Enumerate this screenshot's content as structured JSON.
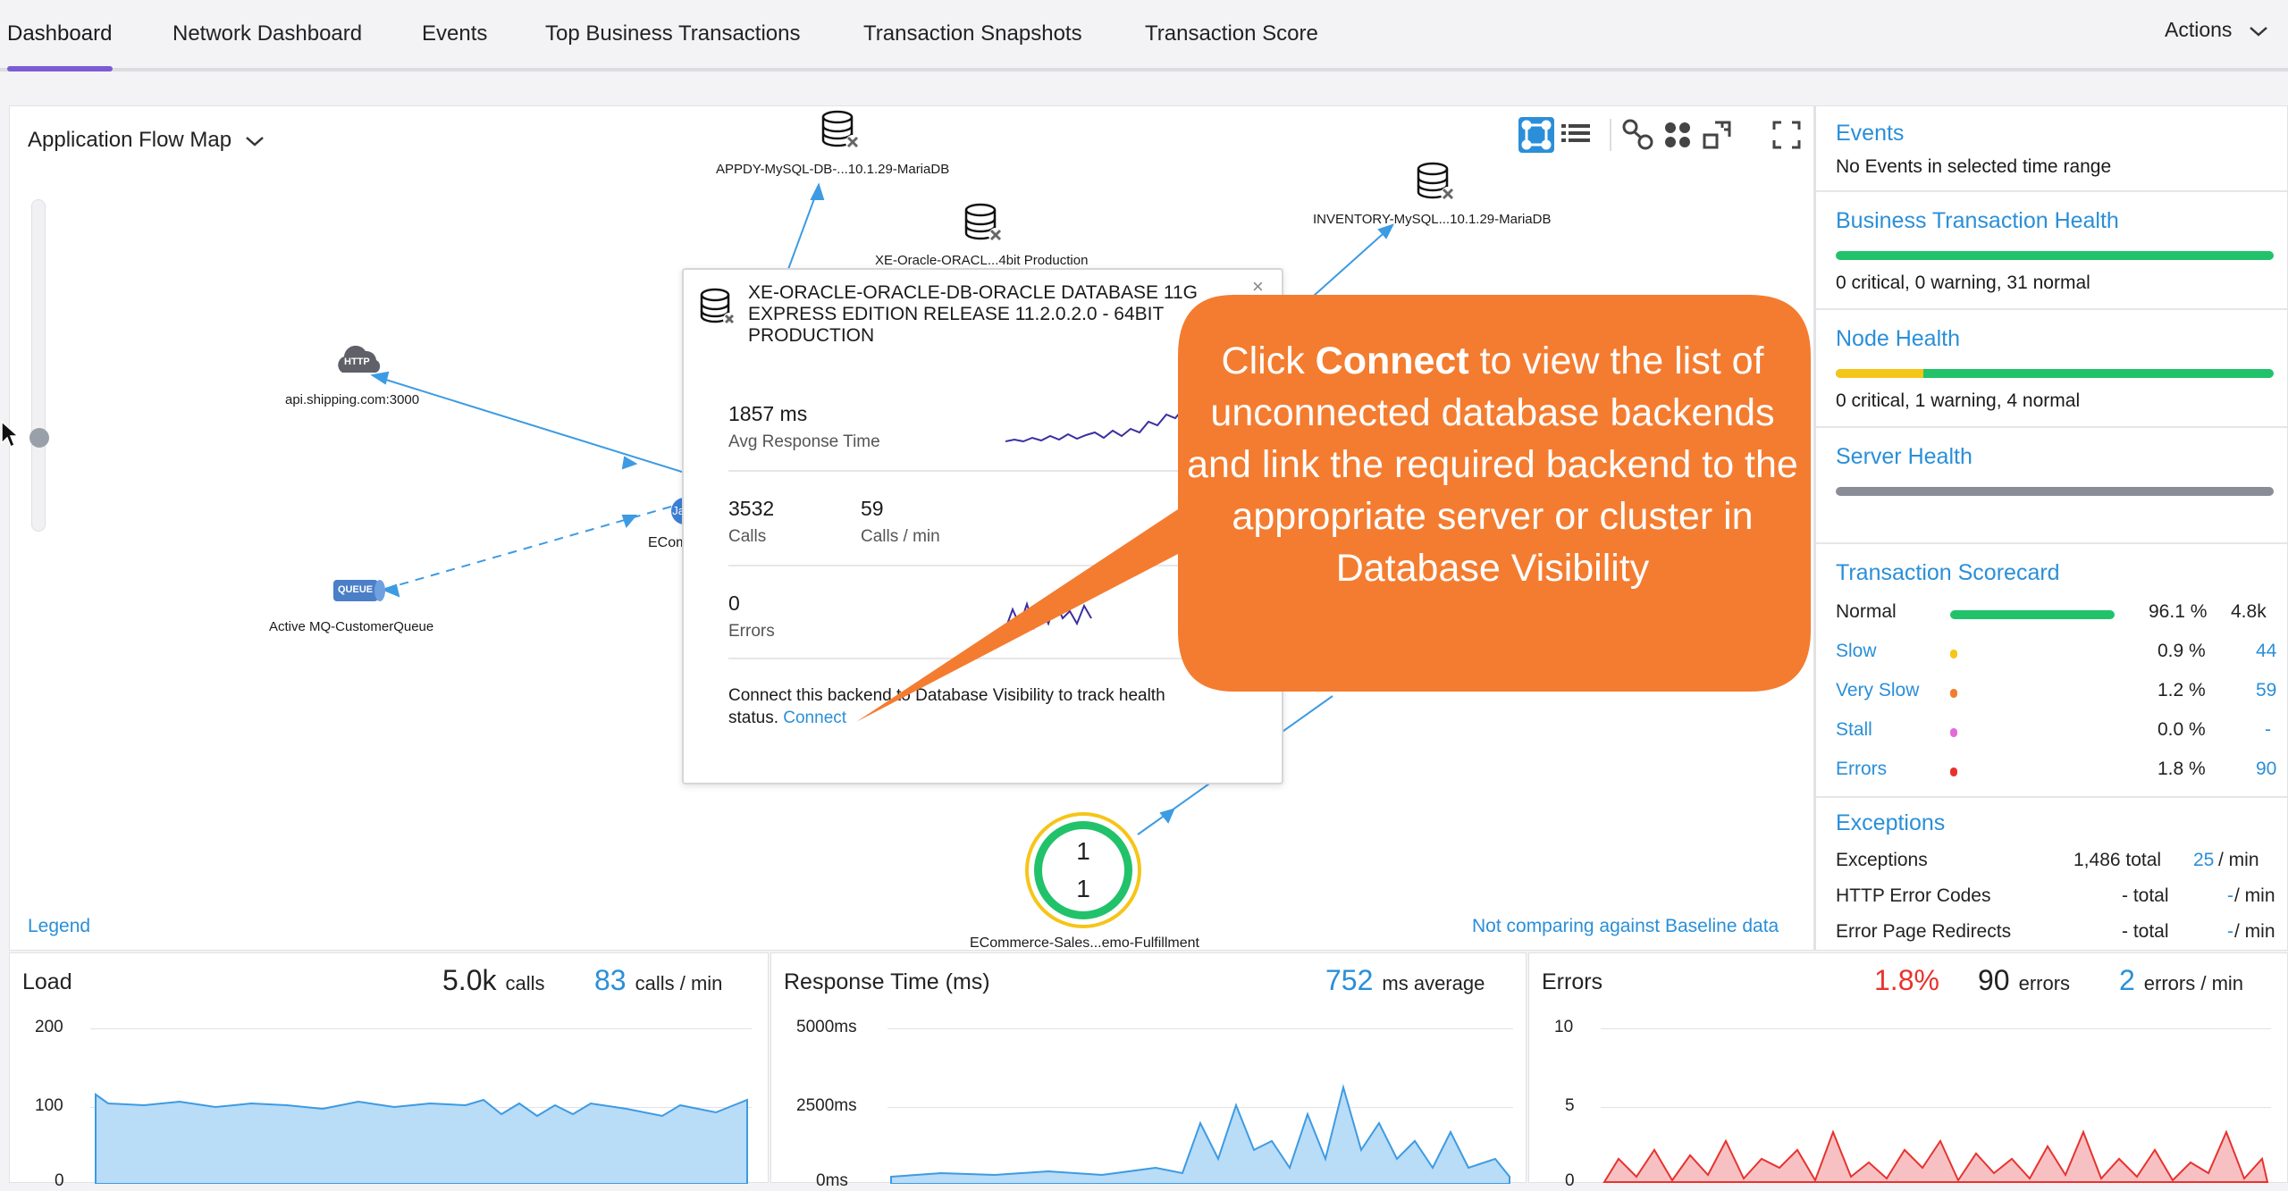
{
  "tabs": [
    {
      "label": "Dashboard"
    },
    {
      "label": "Network Dashboard"
    },
    {
      "label": "Events"
    },
    {
      "label": "Top Business Transactions"
    },
    {
      "label": "Transaction Snapshots"
    },
    {
      "label": "Transaction Score"
    }
  ],
  "actions_label": "Actions",
  "flowmap": {
    "title": "Application Flow Map",
    "legend": "Legend",
    "baseline": "Not comparing against Baseline data",
    "nodes": {
      "mysql_appdy": "APPDY-MySQL-DB-...10.1.29-MariaDB",
      "oracle": "XE-Oracle-ORACL...4bit Production",
      "inventory": "INVENTORY-MySQL...10.1.29-MariaDB",
      "http": "api.shipping.com:3000",
      "http_badge": "HTTP",
      "queue": "Active MQ-CustomerQueue",
      "queue_badge": "QUEUE",
      "ecom_partial": "ECom",
      "java_badge": "Java",
      "fulfillment": "ECommerce-Sales...emo-Fulfillment",
      "fulfillment_top": "1",
      "fulfillment_bottom": "1"
    }
  },
  "popup": {
    "title_line1": "XE-ORACLE-ORACLE-DB-ORACLE DATABASE 11G",
    "title_line2": "EXPRESS EDITION RELEASE 11.2.0.2.0 - 64BIT",
    "title_line3": "PRODUCTION",
    "avg_response_value": "1857 ms",
    "avg_response_label": "Avg Response Time",
    "calls_value": "3532",
    "calls_label": "Calls",
    "calls_min_value": "59",
    "calls_min_label": "Calls / min",
    "errors_value": "0",
    "errors_label": "Errors",
    "connect_text_line1": "Connect this backend to Database Visibility to track health",
    "connect_text_line2": "status.",
    "connect_link": "Connect"
  },
  "callout": {
    "before": "Click ",
    "bold": "Connect",
    "after": " to view the list of unconnected database backends and link the required backend to the appropriate server or cluster in Database Visibility",
    "color": "#f47c30"
  },
  "side": {
    "events_title": "Events",
    "events_text": "No Events in selected time range",
    "bt_health_title": "Business Transaction Health",
    "bt_health_text": "0 critical, 0 warning, 31 normal",
    "node_health_title": "Node Health",
    "node_health_text": "0 critical, 1 warning, 4 normal",
    "server_health_title": "Server Health",
    "scorecard_title": "Transaction Scorecard",
    "scorecard": [
      {
        "label": "Normal",
        "pct": "96.1 %",
        "count": "4.8k",
        "color": "#22c26b"
      },
      {
        "label": "Slow",
        "pct": "0.9 %",
        "count": "44",
        "color": "#f5c518"
      },
      {
        "label": "Very Slow",
        "pct": "1.2 %",
        "count": "59",
        "color": "#f47c30"
      },
      {
        "label": "Stall",
        "pct": "0.0 %",
        "count": "-",
        "color": "#e36bd8"
      },
      {
        "label": "Errors",
        "pct": "1.8 %",
        "count": "90",
        "color": "#e8322e"
      }
    ],
    "exceptions_title": "Exceptions",
    "exceptions": [
      {
        "label": "Exceptions",
        "total": "1,486 total",
        "rate": "25",
        "per": " / min"
      },
      {
        "label": "HTTP Error Codes",
        "total": "- total",
        "rate": "-",
        "per": " / min"
      },
      {
        "label": "Error Page Redirects",
        "total": "- total",
        "rate": "-",
        "per": " / min"
      }
    ]
  },
  "load": {
    "title": "Load",
    "total": "5.0k",
    "total_unit": "calls",
    "rate": "83",
    "rate_unit": "calls / min",
    "yticks": [
      "200",
      "100",
      "0"
    ]
  },
  "response": {
    "title": "Response Time (ms)",
    "avg": "752",
    "avg_unit": "ms average",
    "yticks": [
      "5000ms",
      "2500ms",
      "0ms"
    ]
  },
  "errors": {
    "title": "Errors",
    "pct": "1.8%",
    "count": "90",
    "count_unit": "errors",
    "rate": "2",
    "rate_unit": "errors / min",
    "yticks": [
      "10",
      "5",
      "0"
    ]
  },
  "colors": {
    "accent": "#2a8fd8",
    "tab_underline": "#7b5cd6",
    "normal": "#22c26b",
    "warning": "#f5c518",
    "server_bar": "#8a8d96",
    "error_red": "#e8322e",
    "load_fill": "#b9dcf7",
    "error_fill": "#f7c1c4"
  }
}
